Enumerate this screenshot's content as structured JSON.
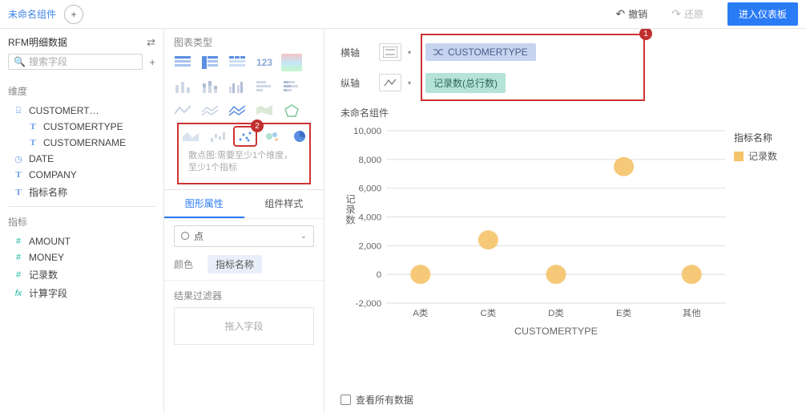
{
  "topbar": {
    "title": "未命名组件",
    "undo": "撤销",
    "redo": "还原",
    "enter_dashboard": "进入仪表板"
  },
  "sidebar": {
    "dataset_name": "RFM明细数据",
    "search_placeholder": "搜索字段",
    "dimension_label": "维度",
    "indicator_label": "指标",
    "dim_fields": [
      {
        "icon": "table",
        "label": "CUSTOMERT…",
        "sub": false
      },
      {
        "icon": "text",
        "label": "CUSTOMERTYPE",
        "sub": true
      },
      {
        "icon": "text",
        "label": "CUSTOMERNAME",
        "sub": true
      },
      {
        "icon": "date",
        "label": "DATE",
        "sub": false
      },
      {
        "icon": "text",
        "label": "COMPANY",
        "sub": false
      },
      {
        "icon": "text",
        "label": "指标名称",
        "sub": false
      }
    ],
    "ind_fields": [
      {
        "icon": "hash",
        "label": "AMOUNT"
      },
      {
        "icon": "hash",
        "label": "MONEY"
      },
      {
        "icon": "hash",
        "label": "记录数"
      },
      {
        "icon": "fx",
        "label": "计算字段"
      }
    ]
  },
  "mid": {
    "chart_type_label": "图表类型",
    "chart_hint": "散点图:需要至少1个维度，至少1个指标",
    "tab_graphic": "图形属性",
    "tab_style": "组件样式",
    "shape_label": "点",
    "color_label": "颜色",
    "color_field": "指标名称",
    "filter_label": "结果过滤器",
    "drop_hint": "拖入字段"
  },
  "right": {
    "x_label": "横轴",
    "y_label": "纵轴",
    "x_pill": "CUSTOMERTYPE",
    "y_pill": "记录数(总行数)",
    "chart_title": "未命名组件",
    "legend_title": "指标名称",
    "legend_item": "记录数",
    "x_axis_title": "CUSTOMERTYPE",
    "y_axis_title": "记录数",
    "view_all": "查看所有数据"
  },
  "markers": {
    "m1": "1",
    "m2": "2"
  },
  "chart_data": {
    "type": "scatter",
    "categories": [
      "A类",
      "C类",
      "D类",
      "E类",
      "其他"
    ],
    "values": [
      0,
      2400,
      0,
      7500,
      0
    ],
    "xlabel": "CUSTOMERTYPE",
    "ylabel": "记录数",
    "ylim": [
      -2000,
      10000
    ],
    "y_ticks": [
      -2000,
      0,
      2000,
      4000,
      6000,
      8000,
      10000
    ],
    "title": "未命名组件"
  }
}
